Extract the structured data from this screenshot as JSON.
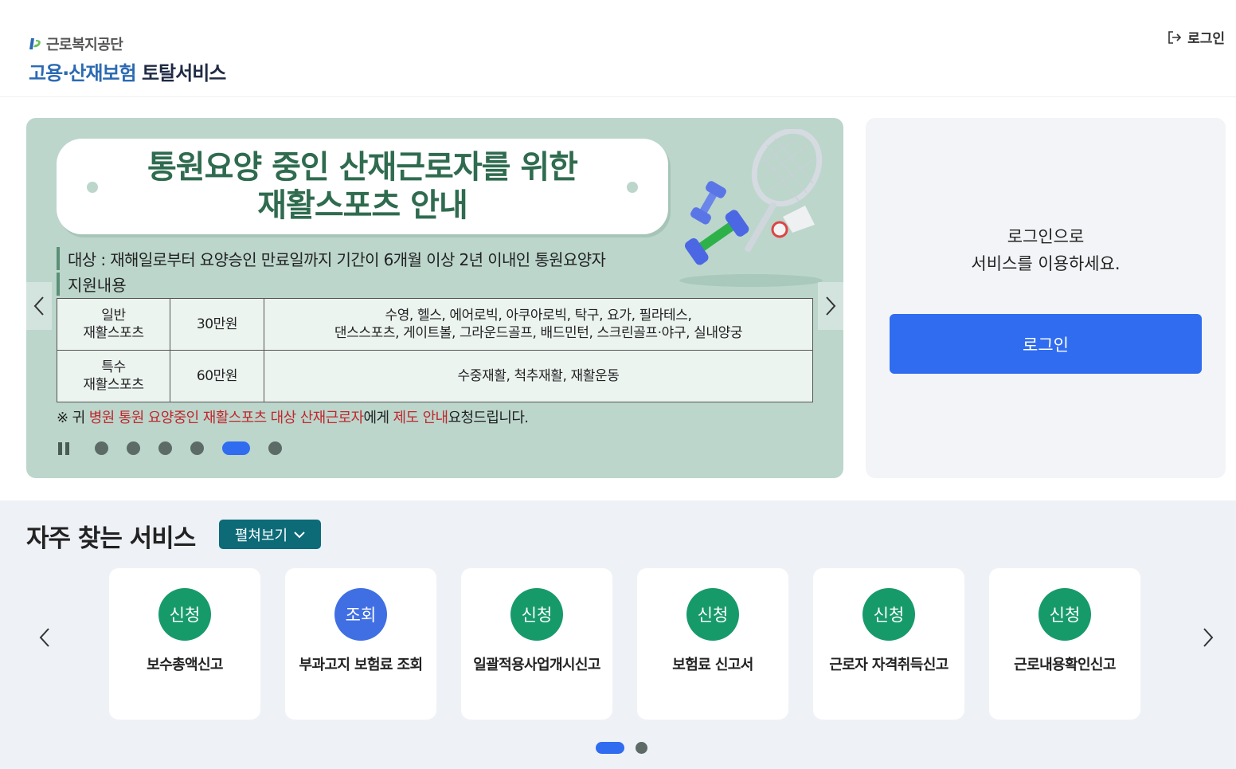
{
  "header": {
    "org_name": "근로복지공단",
    "service_blue": "고용·산재보험",
    "service_dark": "토탈서비스",
    "login_link": "로그인"
  },
  "banner": {
    "title_line1": "통원요양 중인 산재근로자를 위한",
    "title_line2": "재활스포츠 안내",
    "target": "대상 : 재해일로부터 요양승인 만료일까지 기간이 6개월 이상 2년 이내인 통원요양자",
    "support_heading": "지원내용",
    "table": [
      {
        "type_line1": "일반",
        "type_line2": "재활스포츠",
        "amount": "30만원",
        "detail_line1": "수영, 헬스, 에어로빅, 아쿠아로빅, 탁구, 요가, 필라테스,",
        "detail_line2": "댄스스포츠, 게이트볼, 그라운드골프, 배드민턴, 스크린골프·야구, 실내양궁"
      },
      {
        "type_line1": "특수",
        "type_line2": "재활스포츠",
        "amount": "60만원",
        "detail_line1": "수중재활, 척추재활, 재활운동",
        "detail_line2": ""
      }
    ],
    "note_parts": [
      "※ 귀 ",
      "병원 통원 요양중인 재활스포츠 대상 산재근로자",
      "에게 ",
      "제도 안내",
      "요청드립니다."
    ],
    "slide_count": 6,
    "active_slide": 5
  },
  "login_panel": {
    "message_line1": "로그인으로",
    "message_line2": "서비스를 이용하세요.",
    "button": "로그인"
  },
  "frequent": {
    "title": "자주 찾는 서비스",
    "expand_button": "펼쳐보기",
    "cards": [
      {
        "badge": "신청",
        "badge_color": "#179a6a",
        "label": "보수총액신고"
      },
      {
        "badge": "조회",
        "badge_color": "#3f6fe2",
        "label": "부과고지 보험료 조회"
      },
      {
        "badge": "신청",
        "badge_color": "#179a6a",
        "label": "일괄적용사업개시신고"
      },
      {
        "badge": "신청",
        "badge_color": "#179a6a",
        "label": "보험료 신고서"
      },
      {
        "badge": "신청",
        "badge_color": "#179a6a",
        "label": "근로자 자격취득신고"
      },
      {
        "badge": "신청",
        "badge_color": "#179a6a",
        "label": "근로내용확인신고"
      }
    ],
    "page_count": 2,
    "active_page": 1
  },
  "colors": {
    "accent_blue": "#2f6cf0",
    "badge_green": "#179a6a",
    "badge_blue": "#3f6fe2",
    "expand_teal": "#0d6b78",
    "banner_bg": "#bcd6cc"
  }
}
